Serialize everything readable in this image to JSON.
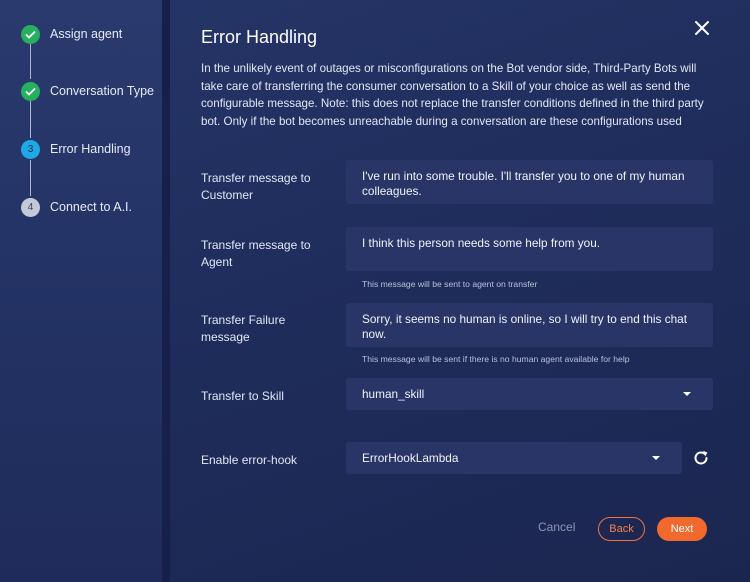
{
  "steps": [
    {
      "number": "1",
      "label": "Assign agent",
      "state": "done"
    },
    {
      "number": "2",
      "label": "Conversation Type",
      "state": "done"
    },
    {
      "number": "3",
      "label": "Error Handling",
      "state": "active"
    },
    {
      "number": "4",
      "label": "Connect to A.I.",
      "state": "pending"
    }
  ],
  "header": {
    "title": "Error Handling",
    "close_icon": "close-icon"
  },
  "description": "In the unlikely event of outages or misconfigurations on the Bot vendor side, Third-Party Bots will take care of transferring the consumer conversation to a Skill of your choice as well as send the configurable message. Note: this does not replace the transfer conditions defined in the third party bot. Only if the bot becomes unreachable during a conversation are these configurations used",
  "form": {
    "customer_message": {
      "label": "Transfer message to Customer",
      "value": "I've run into some trouble. I'll transfer you to one of my human colleagues."
    },
    "agent_message": {
      "label": "Transfer message to Agent",
      "value": "I think this person needs some help from you.",
      "hint": "This message will be sent to agent on transfer"
    },
    "failure_message": {
      "label": "Transfer Failure message",
      "value": "Sorry, it seems no human is online, so I will try to end this chat now.",
      "hint": "This message will be sent if there is no human agent available for help"
    },
    "skill": {
      "label": "Transfer to Skill",
      "value": "human_skill"
    },
    "error_hook": {
      "label": "Enable error-hook",
      "value": "ErrorHookLambda",
      "refresh_icon": "refresh-icon"
    }
  },
  "footer": {
    "cancel_label": "Cancel",
    "back_label": "Back",
    "next_label": "Next"
  },
  "colors": {
    "step_done": "#25b05f",
    "step_active": "#1fa8e6",
    "step_pending": "#c4c9d6",
    "accent": "#f2692e",
    "panel_bg": "#1f2d5c"
  }
}
